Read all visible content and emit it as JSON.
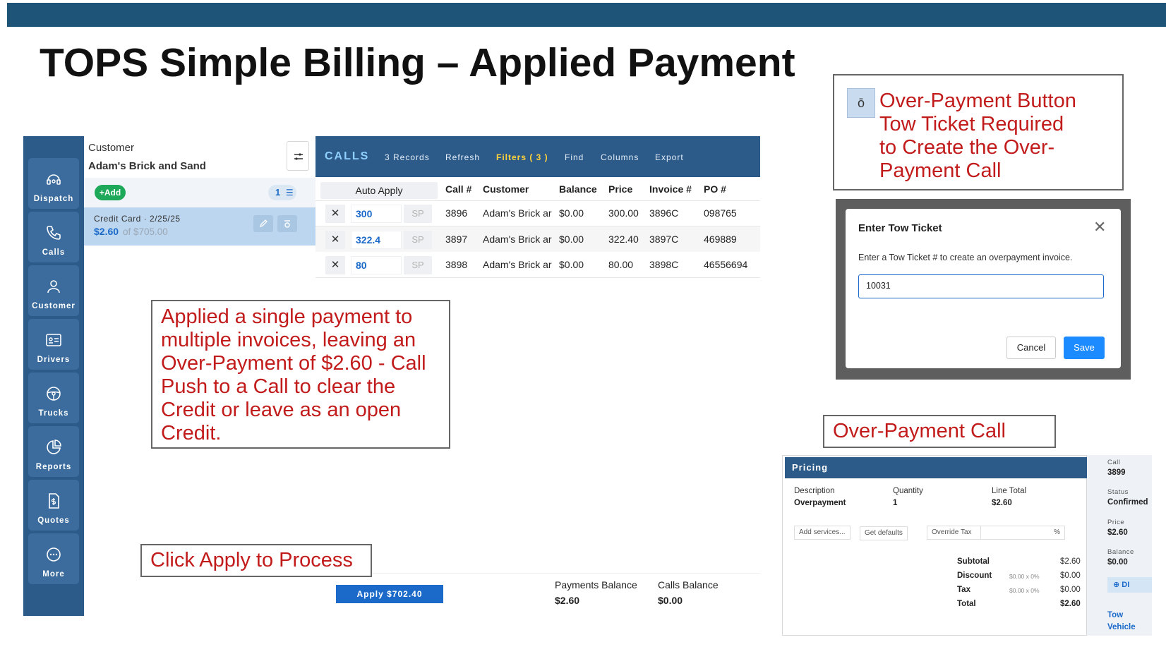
{
  "title": "TOPS Simple Billing – Applied Payment",
  "sidebar": {
    "items": [
      {
        "label": "Dispatch",
        "icon": "dispatch-icon"
      },
      {
        "label": "Calls",
        "icon": "phone-icon"
      },
      {
        "label": "Customer",
        "icon": "customer-icon"
      },
      {
        "label": "Drivers",
        "icon": "id-card-icon"
      },
      {
        "label": "Trucks",
        "icon": "steering-wheel-icon"
      },
      {
        "label": "Reports",
        "icon": "pie-chart-icon"
      },
      {
        "label": "Quotes",
        "icon": "quote-doc-icon"
      },
      {
        "label": "More",
        "icon": "more-dots-icon"
      }
    ]
  },
  "customer_panel": {
    "label": "Customer",
    "name": "Adam's Brick and Sand",
    "add_label": "+Add",
    "count": "1",
    "credit": {
      "title": "Credit Card · 2/25/25",
      "amount": "$2.60",
      "of_total": "of $705.00"
    }
  },
  "calls": {
    "title": "CALLS",
    "menu": [
      "3 Records",
      "Refresh",
      "Filters ( 3 )",
      "Find",
      "Columns",
      "Export"
    ],
    "auto_apply": "Auto Apply",
    "columns": [
      "Call #",
      "Customer",
      "Balance",
      "Price",
      "Invoice #",
      "PO #"
    ],
    "rows": [
      {
        "remove": "✕",
        "amount": "300",
        "sp": "SP",
        "call": "3896",
        "customer": "Adam's Brick ar",
        "balance": "$0.00",
        "price": "300.00",
        "invoice": "3896C",
        "po": "098765"
      },
      {
        "remove": "✕",
        "amount": "322.4",
        "sp": "SP",
        "call": "3897",
        "customer": "Adam's Brick ar",
        "balance": "$0.00",
        "price": "322.40",
        "invoice": "3897C",
        "po": "469889"
      },
      {
        "remove": "✕",
        "amount": "80",
        "sp": "SP",
        "call": "3898",
        "customer": "Adam's Brick ar",
        "balance": "$0.00",
        "price": "80.00",
        "invoice": "3898C",
        "po": "46556694"
      }
    ],
    "footer": {
      "apply_label": "Apply $702.40",
      "payments_balance_label": "Payments Balance",
      "payments_balance_value": "$2.60",
      "calls_balance_label": "Calls Balance",
      "calls_balance_value": "$0.00"
    }
  },
  "callouts": {
    "applied": "Applied a single payment to multiple invoices, leaving an Over-Payment of $2.60 - Call Push to a Call to clear the Credit or leave as an open Credit.",
    "click_apply": "Click Apply to Process",
    "over_payment_button": {
      "icon_glyph": "ō",
      "lines": [
        "Over-Payment Button",
        "Tow Ticket Required",
        "to Create the Over-",
        "Payment Call"
      ]
    },
    "over_payment_call": "Over-Payment Call"
  },
  "modal": {
    "title": "Enter Tow Ticket",
    "close": "✕",
    "description": "Enter a Tow Ticket # to create an overpayment invoice.",
    "input_value": "10031",
    "cancel_label": "Cancel",
    "save_label": "Save"
  },
  "pricing": {
    "header": "Pricing",
    "col_description": "Description",
    "col_quantity": "Quantity",
    "col_line_total": "Line Total",
    "item_description": "Overpayment",
    "item_quantity": "1",
    "item_line_total": "$2.60",
    "add_services": "Add services...",
    "get_defaults": "Get defaults",
    "override_tax": "Override Tax",
    "percent": "%",
    "subtotal_label": "Subtotal",
    "subtotal_value": "$2.60",
    "discount_label": "Discount",
    "discount_detail": "$0.00 x 0%",
    "discount_value": "$0.00",
    "tax_label": "Tax",
    "tax_detail": "$0.00 x 0%",
    "tax_value": "$0.00",
    "total_label": "Total",
    "total_value": "$2.60",
    "side": {
      "call_label": "Call",
      "call_value": "3899",
      "status_label": "Status",
      "status_value": "Confirmed",
      "price_label": "Price",
      "price_value": "$2.60",
      "balance_label": "Balance",
      "balance_value": "$0.00",
      "button_label": "DI",
      "link1": "Tow",
      "link2": "Vehicle"
    }
  },
  "colors": {
    "brand_bar": "#1d5477",
    "nav_bg": "#2c5a89",
    "accent_blue": "#1b6ac9",
    "callout_red": "#c21b1b",
    "add_green": "#1ea85a"
  }
}
